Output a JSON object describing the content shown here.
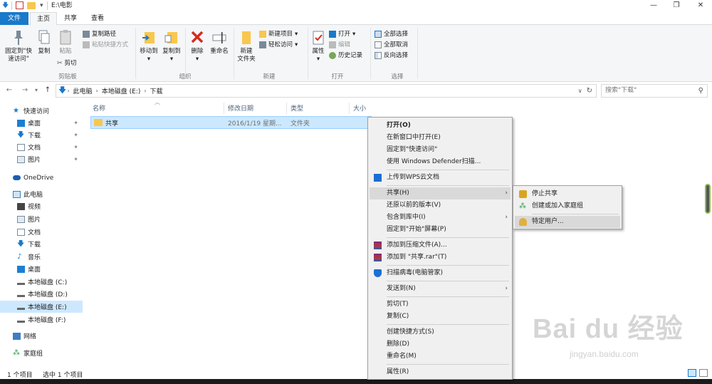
{
  "window": {
    "path_title": "E:\\电影",
    "minimize": "—",
    "maximize": "❐",
    "close": "✕"
  },
  "tabs": [
    {
      "label": "文件"
    },
    {
      "label": "主页"
    },
    {
      "label": "共享"
    },
    {
      "label": "查看"
    }
  ],
  "ribbon": {
    "clipboard": {
      "pin_label": "固定到\"快速访问\"",
      "copy_label": "复制",
      "paste_label": "粘贴",
      "copy_path": "复制路径",
      "paste_shortcut": "粘贴快捷方式",
      "cut": "剪切",
      "group": "剪贴板"
    },
    "organize": {
      "move_to": "移动到",
      "copy_to": "复制到",
      "delete": "删除",
      "rename": "重命名",
      "group": "组织"
    },
    "new": {
      "new_folder": "新建\n文件夹",
      "new_item": "新建项目",
      "easy_access": "轻松访问",
      "group": "新建"
    },
    "open": {
      "properties": "属性",
      "open": "打开",
      "edit": "编辑",
      "history": "历史记录",
      "group": "打开"
    },
    "select": {
      "select_all": "全部选择",
      "select_none": "全部取消",
      "invert": "反向选择",
      "group": "选择"
    }
  },
  "address": {
    "crumbs": [
      "此电脑",
      "本地磁盘 (E:)",
      "下载"
    ],
    "search_placeholder": "搜索\"下载\""
  },
  "nav": {
    "quick_access": "快速访问",
    "quick_items": [
      "桌面",
      "下载",
      "文档",
      "图片"
    ],
    "onedrive": "OneDrive",
    "this_pc": "此电脑",
    "pc_items": [
      "视频",
      "图片",
      "文档",
      "下载",
      "音乐",
      "桌面",
      "本地磁盘 (C:)",
      "本地磁盘 (D:)",
      "本地磁盘 (E:)",
      "本地磁盘 (F:)"
    ],
    "network": "网络",
    "homegroup": "家庭组"
  },
  "columns": {
    "name": "名称",
    "date": "修改日期",
    "type": "类型",
    "size": "大小"
  },
  "files": [
    {
      "name": "共享",
      "date": "2016/1/19 星期...",
      "type": "文件夹"
    }
  ],
  "status": {
    "count": "1 个项目",
    "selected": "选中 1 个项目"
  },
  "context_menu": {
    "open": "打开(O)",
    "open_new_window": "在新窗口中打开(E)",
    "pin_quick": "固定到\"快速访问\"",
    "defender": "使用 Windows Defender扫描...",
    "wps": "上传到WPS云文档",
    "share": "共享(H)",
    "restore": "还原以前的版本(V)",
    "library": "包含到库中(I)",
    "pin_start": "固定到\"开始\"屏幕(P)",
    "add_archive": "添加到压缩文件(A)...",
    "add_rar": "添加到 \"共享.rar\"(T)",
    "pc_manager": "扫描病毒(电脑管家)",
    "send_to": "发送到(N)",
    "cut": "剪切(T)",
    "copy": "复制(C)",
    "create_shortcut": "创建快捷方式(S)",
    "delete": "删除(D)",
    "rename": "重命名(M)",
    "properties": "属性(R)"
  },
  "share_submenu": {
    "stop": "停止共享",
    "homegroup": "创建或加入家庭组",
    "specific": "特定用户..."
  },
  "watermark": {
    "logo": "Bai du 经验",
    "url": "jingyan.baidu.com"
  },
  "colors": {
    "accent": "#1979ca",
    "selection": "#cce8ff",
    "folder": "#f8c74d"
  }
}
